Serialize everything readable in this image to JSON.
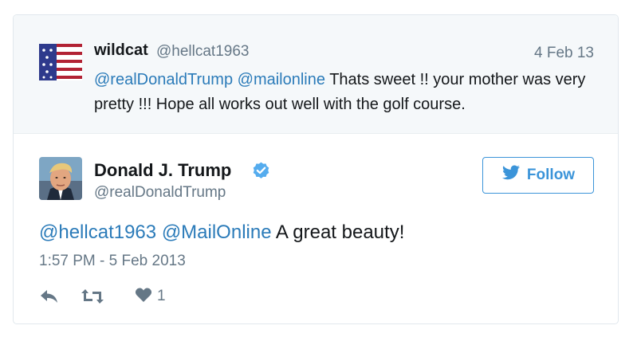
{
  "parent_tweet": {
    "name": "wildcat",
    "handle": "@hellcat1963",
    "date": "4 Feb 13",
    "mention_1": "@realDonaldTrump",
    "mention_2": "@mailonline",
    "text": "Thats sweet !! your mother was very pretty !!! Hope all works out well with the golf course.",
    "avatar_icon": "us-flag-icon"
  },
  "main_tweet": {
    "name": "Donald J. Trump",
    "handle": "@realDonaldTrump",
    "verified_icon": "verified-badge-icon",
    "follow_label": "Follow",
    "mention_1": "@hellcat1963",
    "mention_2": "@MailOnline",
    "text": "A great beauty!",
    "timestamp": "1:57 PM - 5 Feb 2013",
    "like_count": "1",
    "avatar_icon": "profile-photo"
  },
  "colors": {
    "link": "#2b7bb9",
    "follow_blue": "#3b94d9",
    "muted": "#657786",
    "parent_bg": "#f5f8fa"
  }
}
